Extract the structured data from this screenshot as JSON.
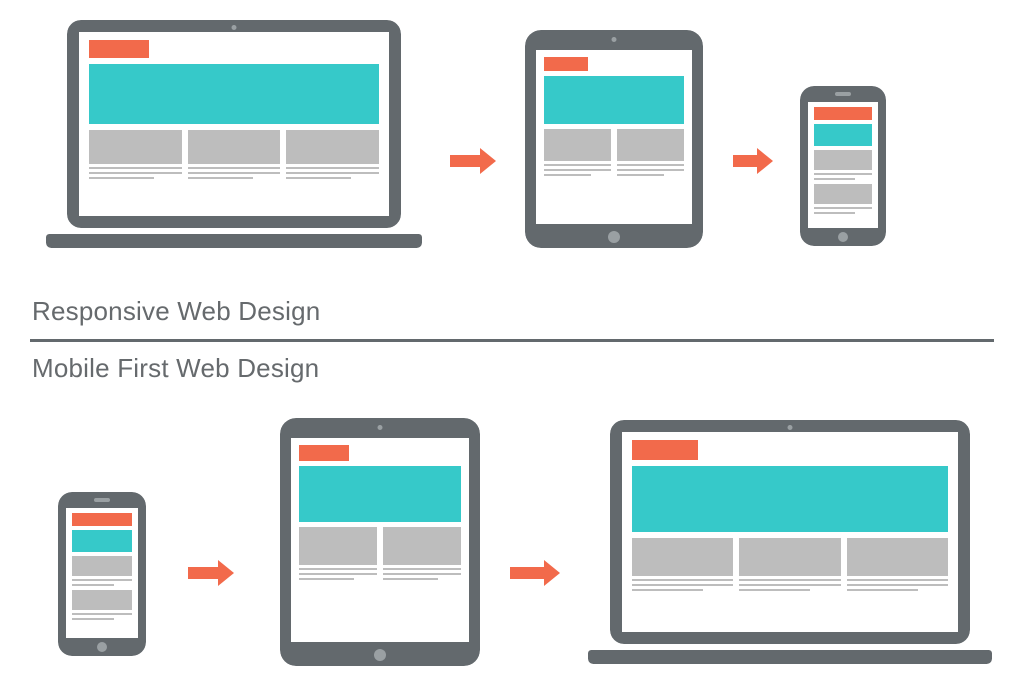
{
  "labels": {
    "top": "Responsive Web Design",
    "bottom": "Mobile First Web Design"
  },
  "colors": {
    "device_frame": "#63696d",
    "outline": "#ffffff",
    "accent_logo": "#f26a4b",
    "accent_hero": "#36c9c9",
    "placeholder": "#bdbdbd",
    "arrow": "#f26a4b",
    "text": "#666a6d"
  },
  "diagram": {
    "top_row": {
      "flow": [
        "laptop",
        "tablet",
        "phone"
      ],
      "caption_key": "labels.top"
    },
    "bottom_row": {
      "flow": [
        "phone",
        "tablet",
        "laptop"
      ],
      "caption_key": "labels.bottom"
    }
  },
  "devices": {
    "laptop": {
      "columns": 3
    },
    "tablet": {
      "columns": 2
    },
    "phone": {
      "columns": 1
    }
  }
}
